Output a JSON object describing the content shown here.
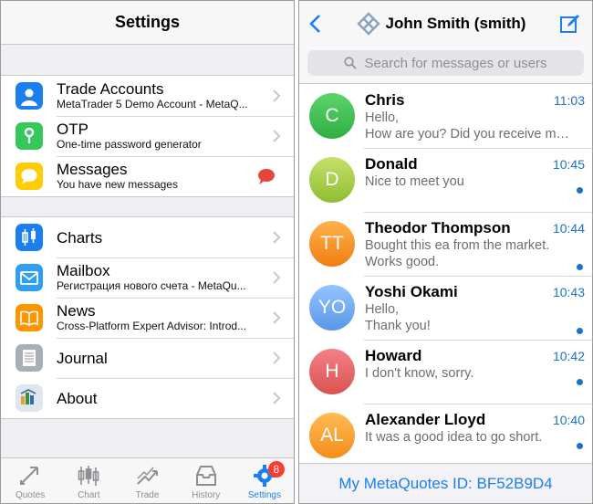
{
  "settings": {
    "title": "Settings",
    "group1": [
      {
        "icon": "user-icon",
        "title": "Trade Accounts",
        "subtitle": "MetaTrader 5 Demo Account - MetaQ...",
        "color": "#1b7ff0"
      },
      {
        "icon": "key-icon",
        "title": "OTP",
        "subtitle": "One-time password generator",
        "color": "#34c759"
      },
      {
        "icon": "message-icon",
        "title": "Messages",
        "subtitle": "You have new messages",
        "color": "#ffcc00"
      }
    ],
    "group2": [
      {
        "icon": "candles-icon",
        "title": "Charts",
        "color": "#1b7ff0"
      },
      {
        "icon": "envelope-icon",
        "title": "Mailbox",
        "subtitle": "Регистрация нового счета - MetaQu...",
        "color": "#2f9ff5"
      },
      {
        "icon": "book-icon",
        "title": "News",
        "subtitle": "Cross-Platform Expert Advisor: Introd...",
        "color": "#ff9500"
      },
      {
        "icon": "journal-icon",
        "title": "Journal",
        "color": "#a9afb8"
      },
      {
        "icon": "metatrader-icon",
        "title": "About",
        "color": "#3f6f9e"
      }
    ],
    "messages_alert_color": "#e5463a"
  },
  "tabs": [
    {
      "icon": "quotes-icon",
      "label": "Quotes"
    },
    {
      "icon": "chart-icon",
      "label": "Chart"
    },
    {
      "icon": "trade-icon",
      "label": "Trade"
    },
    {
      "icon": "history-icon",
      "label": "History"
    },
    {
      "icon": "settings-gear-icon",
      "label": "Settings",
      "active": true,
      "badge": "8"
    }
  ],
  "chat": {
    "title": "John Smith (smith)",
    "search_placeholder": "Search for messages or users",
    "footer": "My MetaQuotes ID: BF52B9D4",
    "accent": "#1b72c8",
    "items": [
      {
        "initials": "C",
        "name": "Chris",
        "time": "11:03",
        "lines": [
          "Hello,",
          "How are you? Did you receive my e..."
        ],
        "unread": false,
        "color_top": "#5bd46b",
        "color_bottom": "#2fae44"
      },
      {
        "initials": "D",
        "name": "Donald",
        "time": "10:45",
        "lines": [
          "Nice to meet you"
        ],
        "unread": true,
        "color_top": "#c6e06a",
        "color_bottom": "#8dbe32"
      },
      {
        "initials": "TT",
        "name": "Theodor Thompson",
        "time": "10:44",
        "lines": [
          "Bought this ea from the market.",
          "Works good."
        ],
        "unread": true,
        "color_top": "#ffb14a",
        "color_bottom": "#f07d12"
      },
      {
        "initials": "YO",
        "name": "Yoshi Okami",
        "time": "10:43",
        "lines": [
          "Hello,",
          "Thank you!"
        ],
        "unread": true,
        "color_top": "#93c4ff",
        "color_bottom": "#5a97e8"
      },
      {
        "initials": "H",
        "name": "Howard",
        "time": "10:42",
        "lines": [
          "I don't know, sorry."
        ],
        "unread": true,
        "color_top": "#f4808a",
        "color_bottom": "#d9534f"
      },
      {
        "initials": "AL",
        "name": "Alexander Lloyd",
        "time": "10:40",
        "lines": [
          "It was a good idea to go short."
        ],
        "unread": true,
        "color_top": "#ffbb55",
        "color_bottom": "#f38d1a"
      }
    ]
  }
}
